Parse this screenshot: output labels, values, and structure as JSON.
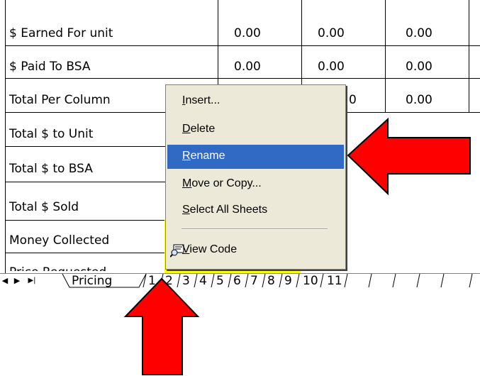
{
  "sheet": {
    "rows": [
      {
        "label": "$ Earned For unit",
        "values": [
          "0.00",
          "0.00",
          "0.00"
        ]
      },
      {
        "label": "$ Paid To BSA",
        "values": [
          "0.00",
          "0.00",
          "0.00"
        ]
      },
      {
        "label": " Total Per Column",
        "values": [
          "0",
          "0.00"
        ]
      },
      {
        "label": "Total $ to Unit"
      },
      {
        "label": " Total $ to BSA"
      },
      {
        "label": "Total $ Sold"
      },
      {
        "label": "Money Collected"
      },
      {
        "label": "Price Requested"
      }
    ]
  },
  "context_menu": {
    "items": [
      {
        "pre": "",
        "u": "I",
        "post": "nsert..."
      },
      {
        "pre": "",
        "u": "D",
        "post": "elete"
      },
      {
        "pre": "",
        "u": "R",
        "post": "ename"
      },
      {
        "pre": "",
        "u": "M",
        "post": "ove or Copy..."
      },
      {
        "pre": "",
        "u": "S",
        "post": "elect All Sheets"
      },
      {
        "pre": "",
        "u": "V",
        "post": "iew Code"
      }
    ],
    "highlighted": "Rename",
    "highlight_color": "#316ac5",
    "background_color": "#ece9d8"
  },
  "tabs": {
    "nav": [
      "◀",
      "▶",
      "▶|"
    ],
    "sheets": [
      "Pricing",
      "1",
      "2",
      "3",
      "4",
      "5",
      "6",
      "7",
      "8",
      "9",
      "10",
      "11"
    ],
    "active": "Pricing"
  },
  "annotations": {
    "arrow_color": "#ff0000",
    "highlight_color": "#ffff00"
  }
}
